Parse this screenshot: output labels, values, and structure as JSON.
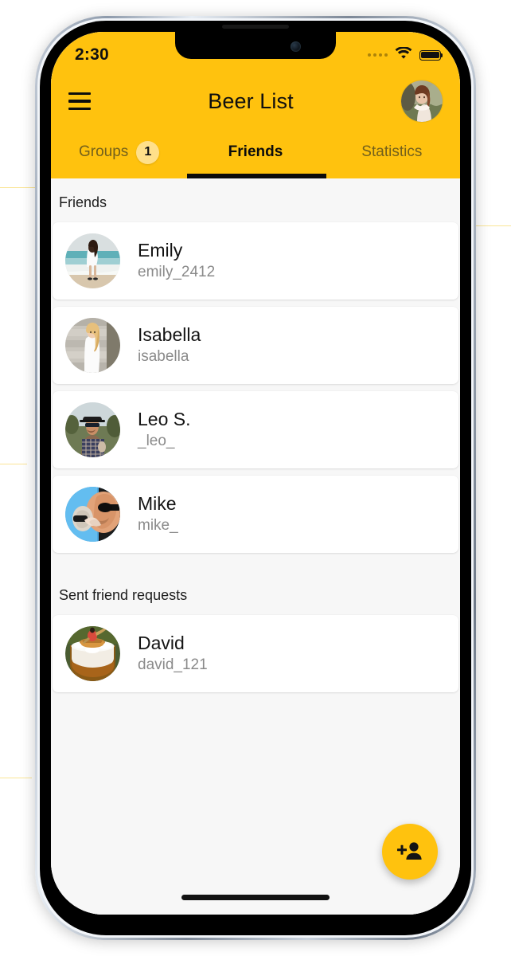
{
  "theme": {
    "brand_yellow": "#FFC20E",
    "badge_yellow": "#FFE08A",
    "page_background": "#F7F7F7",
    "card_background": "#FFFFFF",
    "primary_text": "#141414",
    "secondary_text": "#8A8A8A",
    "inactive_tab_text": "#73601C"
  },
  "status_bar": {
    "time": "2:30",
    "signal_icon": "signal-dots-icon",
    "wifi_icon": "wifi-icon",
    "battery_icon": "battery-full-icon"
  },
  "app_bar": {
    "menu_icon": "hamburger-menu-icon",
    "title": "Beer List",
    "profile_avatar_icon": "user-profile-avatar"
  },
  "tabs": [
    {
      "label": "Groups",
      "active": false,
      "badge": "1"
    },
    {
      "label": "Friends",
      "active": true,
      "badge": null
    },
    {
      "label": "Statistics",
      "active": false,
      "badge": null
    }
  ],
  "sections": [
    {
      "header": "Friends",
      "items": [
        {
          "name": "Emily",
          "handle": "emily_2412",
          "avatar": "beach-woman-avatar"
        },
        {
          "name": "Isabella",
          "handle": "isabella",
          "avatar": "blonde-woman-avatar"
        },
        {
          "name": "Leo S.",
          "handle": "_leo_",
          "avatar": "man-hat-sunglasses-avatar"
        },
        {
          "name": "Mike",
          "handle": "mike_",
          "avatar": "man-drinking-avatar"
        }
      ]
    },
    {
      "header": "Sent friend requests",
      "items": [
        {
          "name": "David",
          "handle": "david_121",
          "avatar": "beer-glass-rower-avatar"
        }
      ]
    }
  ],
  "fab": {
    "icon": "person-add-icon",
    "label": "Add friend"
  },
  "system": {
    "home_indicator": "home-indicator-bar",
    "notch_camera": "front-camera-icon",
    "earpiece": "earpiece-speaker"
  }
}
